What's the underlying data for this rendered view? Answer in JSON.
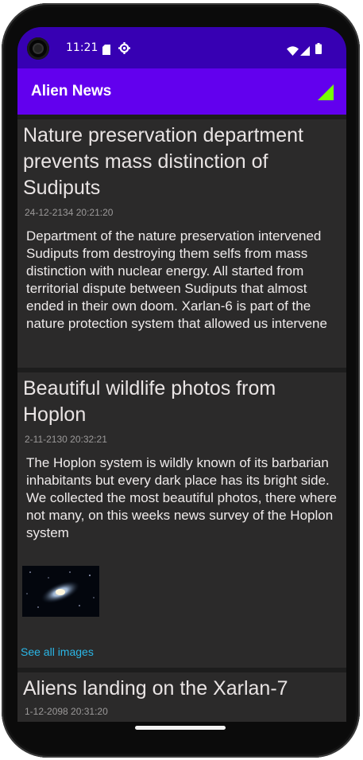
{
  "status_bar": {
    "time": "11:21",
    "icons": [
      "sd-card-icon",
      "settings-icon",
      "wifi-icon",
      "cellular-icon",
      "battery-icon"
    ]
  },
  "app_bar": {
    "title": "Alien News",
    "indicator_icon": "signal-icon",
    "colors": {
      "app_bar": "#6200ee",
      "status_bar": "#3700b3",
      "indicator": "#76ff03"
    }
  },
  "articles": [
    {
      "title": "Nature preservation department prevents mass distinction of Sudiputs",
      "date": "24-12-2134 20:21:20",
      "body": "Department of the nature preservation intervened Sudiputs from destroying them selfs from mass distinction with nuclear energy. All started from territorial dispute between Sudiputs that almost ended in their own doom. Xarlan-6 is part of the nature protection system that allowed us intervene"
    },
    {
      "title": "Beautiful wildlife photos from Hoplon",
      "date": "2-11-2130 20:32:21",
      "body": "The Hoplon system is wildly known of its barbarian inhabitants but every dark place has its bright side. We collected the most beautiful photos, there where not many, on this weeks news survey of the Hoplon system",
      "image": "galaxy-image",
      "see_all_label": "See all images"
    },
    {
      "title": "Aliens landing on the Xarlan-7",
      "date": "1-12-2098 20:31:20"
    }
  ]
}
